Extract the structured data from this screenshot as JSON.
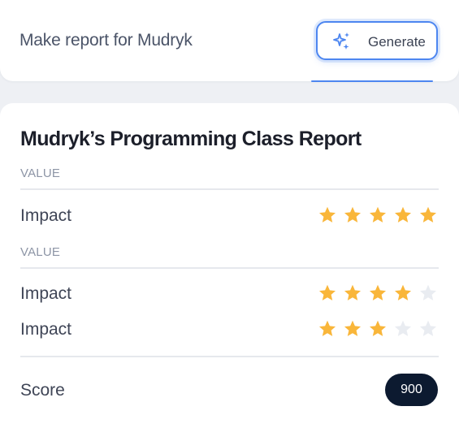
{
  "prompt": {
    "text": "Make report for Mudryk",
    "generate_label": "Generate",
    "icon": "sparkles-icon"
  },
  "report": {
    "title": "Mudryk’s Programming Class Report",
    "sections": [
      {
        "label": "VALUE",
        "rows": [
          {
            "label": "Impact",
            "rating": 5,
            "max": 5
          }
        ]
      },
      {
        "label": "VALUE",
        "rows": [
          {
            "label": "Impact",
            "rating": 4,
            "max": 5
          },
          {
            "label": "Impact",
            "rating": 3,
            "max": 5
          }
        ]
      }
    ],
    "score_label": "Score",
    "score_value": "900"
  },
  "colors": {
    "accent": "#4d86f0",
    "star_filled": "#f9b63a",
    "star_empty": "#e9ecf1",
    "badge_bg": "#0c1a30"
  }
}
